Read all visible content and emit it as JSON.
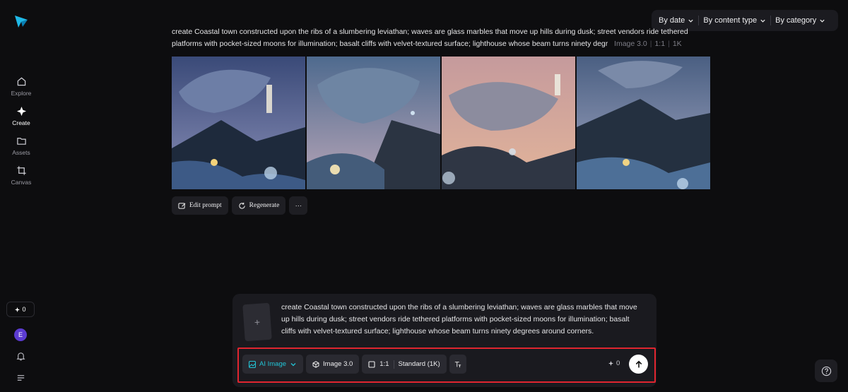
{
  "sidebar": {
    "nav": [
      {
        "label": "Explore",
        "icon": "home-icon"
      },
      {
        "label": "Create",
        "icon": "sparkle-icon"
      },
      {
        "label": "Assets",
        "icon": "folder-icon"
      },
      {
        "label": "Canvas",
        "icon": "crop-icon"
      }
    ],
    "credits": "0",
    "avatar_initial": "E"
  },
  "filters": [
    "By date",
    "By content type",
    "By category"
  ],
  "generation": {
    "prompt_line1": "create Coastal town constructed upon the ribs of a slumbering leviathan; waves are glass marbles that move up hills during dusk; street vendors ride tethered",
    "prompt_line2": "platforms with pocket-sized moons for illumination; basalt cliffs with velvet-textured surface; lighthouse whose beam turns ninety degr",
    "meta": {
      "model": "Image 3.0",
      "ratio": "1:1",
      "resolution": "1K"
    },
    "actions": {
      "edit": "Edit prompt",
      "regenerate": "Regenerate",
      "more": "···"
    }
  },
  "composer": {
    "text": "create Coastal town constructed upon the ribs of a slumbering leviathan; waves are glass marbles that move up hills during dusk; street vendors ride tethered platforms with pocket-sized moons for illumination; basalt cliffs with velvet-textured surface; lighthouse whose beam turns ninety degrees around corners.",
    "upload_symbol": "+",
    "mode": "AI Image",
    "model": "Image 3.0",
    "ratio": "1:1",
    "quality": "Standard (1K)",
    "cost": "0"
  },
  "colors": {
    "accent": "#22c4d6",
    "highlight": "#e0252f",
    "avatar": "#5b3bd1"
  }
}
